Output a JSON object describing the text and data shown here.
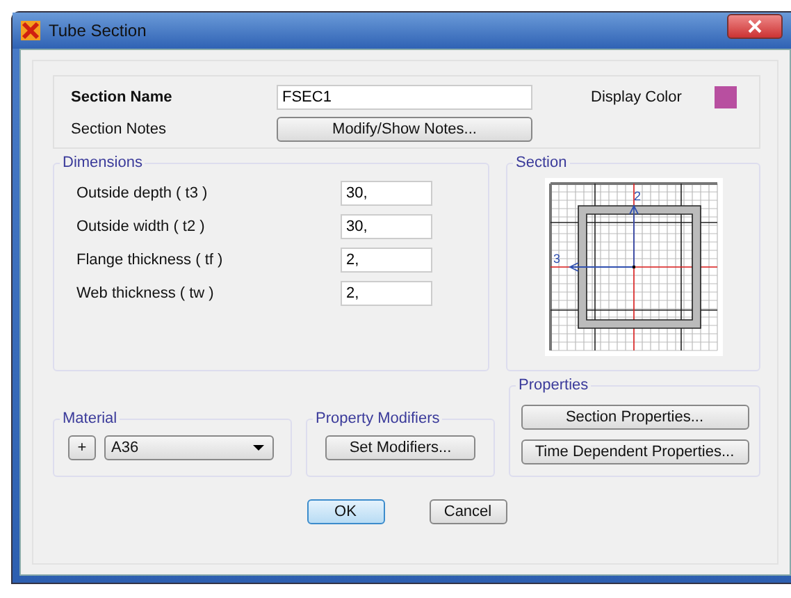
{
  "window": {
    "title": "Tube Section"
  },
  "section_name": {
    "label": "Section Name",
    "value": "FSEC1"
  },
  "display_color": {
    "label": "Display Color",
    "color": "#b84fa0"
  },
  "section_notes": {
    "label": "Section Notes",
    "button": "Modify/Show Notes..."
  },
  "dimensions": {
    "title": "Dimensions",
    "fields": [
      {
        "label": "Outside depth  ( t3 )",
        "value": "30,"
      },
      {
        "label": "Outside width  ( t2 )",
        "value": "30,"
      },
      {
        "label": "Flange thickness  ( tf )",
        "value": "2,"
      },
      {
        "label": "Web thickness  ( tw )",
        "value": "2,"
      }
    ]
  },
  "section": {
    "title": "Section",
    "axis_vertical": "2",
    "axis_horizontal": "3"
  },
  "material": {
    "title": "Material",
    "add_button": "+",
    "value": "A36"
  },
  "property_modifiers": {
    "title": "Property Modifiers",
    "button": "Set Modifiers..."
  },
  "properties": {
    "title": "Properties",
    "buttons": [
      "Section Properties...",
      "Time Dependent Properties..."
    ]
  },
  "buttons": [
    {
      "label": "OK",
      "default": true
    },
    {
      "label": "Cancel",
      "default": false
    }
  ]
}
